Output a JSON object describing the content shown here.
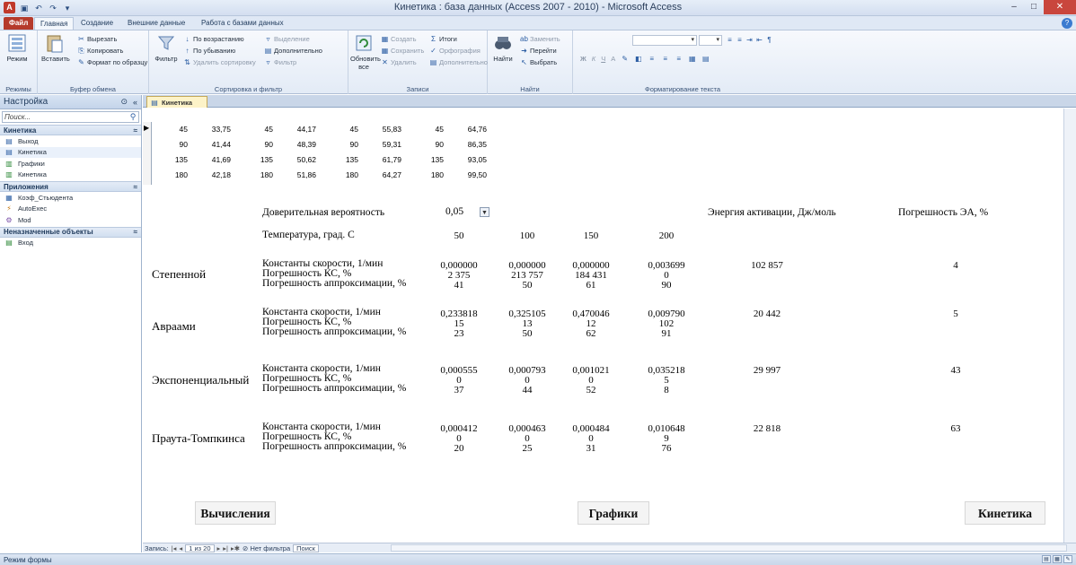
{
  "window": {
    "title": "Кинетика : база данных (Access 2007 - 2010)  -  Microsoft Access",
    "app_icon": "A",
    "qat_icons": [
      "save-icon",
      "undo-icon",
      "redo-icon",
      "customize-icon"
    ]
  },
  "ribbon_tabs": [
    "Файл",
    "Главная",
    "Создание",
    "Внешние данные",
    "Работа с базами данных"
  ],
  "ribbon": {
    "views": {
      "mode": "Режим",
      "label": "Режимы"
    },
    "clipboard": {
      "paste": "Вставить",
      "cut": "Вырезать",
      "copy": "Копировать",
      "format": "Формат по образцу",
      "label": "Буфер обмена"
    },
    "sort": {
      "filter": "Фильтр",
      "asc": "По возрастанию",
      "desc": "По убыванию",
      "remove": "Удалить сортировку",
      "selection": "Выделение",
      "advanced": "Дополнительно",
      "toggle": "Фильтр",
      "label": "Сортировка и фильтр"
    },
    "records": {
      "refresh": "Обновить",
      "refresh_sub": "все",
      "new": "Создать",
      "save": "Сохранить",
      "delete": "Удалить",
      "totals": "Итоги",
      "spelling": "Орфография",
      "more": "Дополнительно",
      "label": "Записи"
    },
    "find": {
      "find": "Найти",
      "replace": "Заменить",
      "goto": "Перейти",
      "select": "Выбрать",
      "label": "Найти"
    },
    "text": {
      "bold": "Ж",
      "italic": "К",
      "underline": "Ч",
      "fontcolor": "А",
      "label": "Форматирование текста"
    }
  },
  "nav": {
    "header": "Настройка",
    "search_placeholder": "Поиск...",
    "groups": [
      {
        "title": "Кинетика",
        "items": [
          "Выход",
          "Кинетика",
          "Графики",
          "Кинетика"
        ]
      },
      {
        "title": "Приложения",
        "items": [
          "Коэф_Стьюдента",
          "AutoExec",
          "Mod"
        ]
      },
      {
        "title": "Неназначенные объекты",
        "items": [
          "Вход"
        ]
      }
    ]
  },
  "doc_tab": "Кинетика",
  "grid_rows": [
    [
      "45",
      "33,75",
      "45",
      "44,17",
      "45",
      "55,83",
      "45",
      "64,76"
    ],
    [
      "90",
      "41,44",
      "90",
      "48,39",
      "90",
      "59,31",
      "90",
      "86,35"
    ],
    [
      "135",
      "41,69",
      "135",
      "50,62",
      "135",
      "61,79",
      "135",
      "93,05"
    ],
    [
      "180",
      "42,18",
      "180",
      "51,86",
      "180",
      "64,27",
      "180",
      "99,50"
    ]
  ],
  "form": {
    "conf_label": "Доверительная вероятность",
    "conf_value": "0,05",
    "temp_label": "Температура, град. С",
    "temps": [
      "50",
      "100",
      "150",
      "200"
    ],
    "ea_label": "Энергия активации, Дж/моль",
    "err_label": "Погрешность ЭА, %",
    "models": [
      {
        "name": "Степенной",
        "lines": [
          "Константы скорости, 1/мин",
          "Погрешность КС, %",
          "Погрешность аппроксимации, %"
        ],
        "cols": [
          [
            "0,000000",
            "2 375",
            "41"
          ],
          [
            "0,000000",
            "213 757",
            "50"
          ],
          [
            "0,000000",
            "184 431",
            "61"
          ],
          [
            "0,003699",
            "0",
            "90"
          ]
        ],
        "ea": "102 857",
        "err": "4"
      },
      {
        "name": "Авраами",
        "lines": [
          "Константа скорости, 1/мин",
          "Погрешность КС, %",
          "Погрешность аппроксимации, %"
        ],
        "cols": [
          [
            "0,233818",
            "15",
            "23"
          ],
          [
            "0,325105",
            "13",
            "50"
          ],
          [
            "0,470046",
            "12",
            "62"
          ],
          [
            "0,009790",
            "102",
            "91"
          ]
        ],
        "ea": "20 442",
        "err": "5"
      },
      {
        "name": "Экспоненциальный",
        "lines": [
          "Константа скорости, 1/мин",
          "Погрешность КС, %",
          "Погрешность аппроксимации, %"
        ],
        "cols": [
          [
            "0,000555",
            "0",
            "37"
          ],
          [
            "0,000793",
            "0",
            "44"
          ],
          [
            "0,001021",
            "0",
            "52"
          ],
          [
            "0,035218",
            "5",
            "8"
          ]
        ],
        "ea": "29 997",
        "err": "43"
      },
      {
        "name": "Праута-Томпкинса",
        "lines": [
          "Константа скорости, 1/мин",
          "Погрешность КС, %",
          "Погрешность аппроксимации, %"
        ],
        "cols": [
          [
            "0,000412",
            "0",
            "20"
          ],
          [
            "0,000463",
            "0",
            "25"
          ],
          [
            "0,000484",
            "0",
            "31"
          ],
          [
            "0,010648",
            "9",
            "76"
          ]
        ],
        "ea": "22 818",
        "err": "63"
      }
    ],
    "buttons": {
      "calc": "Вычисления",
      "charts": "Графики",
      "kinetics": "Кинетика"
    }
  },
  "recnav": {
    "label": "Запись:",
    "position": "1 из 20",
    "filter": "Нет фильтра",
    "search": "Поиск"
  },
  "status": "Режим формы"
}
